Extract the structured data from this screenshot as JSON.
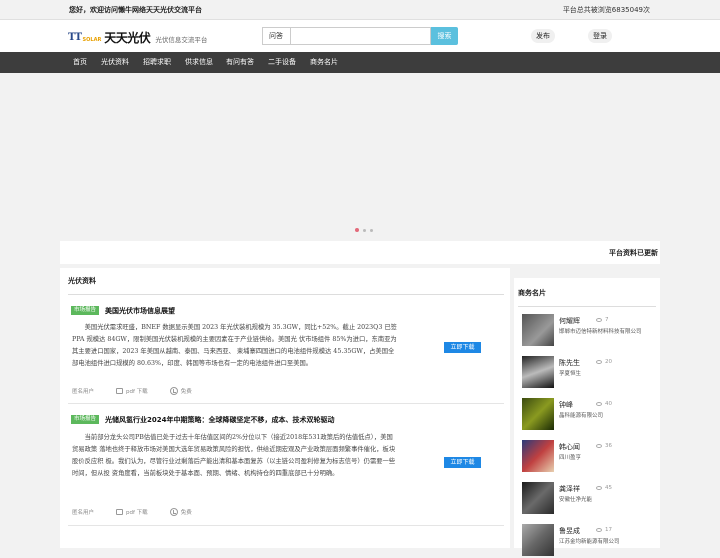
{
  "topbar": {
    "welcome": "您好，欢迎访问懒牛网络天天光伏交流平台",
    "views": "平台总共被浏览6835049次"
  },
  "header": {
    "logo_tt": "TT",
    "logo_solar": "SOLAR",
    "logo_cn": "天天光伏",
    "slogan": "光伏信息交流平台",
    "search_type": "问答",
    "search_value": "",
    "search_button": "搜索",
    "publish": "发布",
    "login": "登录"
  },
  "nav": [
    "首页",
    "光伏资料",
    "招聘求职",
    "供求信息",
    "有问有答",
    "二手设备",
    "商务名片"
  ],
  "notice": {
    "title": "平台资料已更新"
  },
  "main": {
    "section_title": "光伏资料",
    "articles": [
      {
        "tag": "市场报告",
        "title": "美国光伏市场信息展望",
        "body": "美国光伏需求旺盛，BNEF 数据显示美国 2023 年光伏装机规模为 35.3GW，同比+52%。截止 2023Q3 已签 PPA 规模达 84GW，限制美国光伏装机规模的主要因素在于产业链供给。美国光 伏市场组件 85%为进口，东南亚为其主要进口国家，2023 年美国从越南、泰国、马来西亚、 柬埔寨四国进口的电池组件规模达 45.35GW，占美国全部电池组件进口规模的 80.63%，印度、韩国等市场也有一定的电池组件进口至美国。",
        "download": "立即下载",
        "author": "匿名用户",
        "file": "pdf 下载",
        "price": "免费"
      },
      {
        "tag": "市场报告",
        "title": "光储风氢行业2024年中期策略：全球降碳坚定不移，成本、技术双轮驱动",
        "body": "当前部分龙头公司PB估值已处于过去十年估值区间的2%分位以下（接近2018年531政策后的估值低点），美国贸易政策 落地也终于释放市场对美国大选年贸易政策风险的担忧，供给近期宏观及产业政策层面频繁事件催化，板块股价反应积 极。我们认为，尽管行业过剩落后产能出清和基本面复苏（以主链公司盈利修复为标志信号）仍需要一些时间，但从投 资角度看，当前板块处于基本面、预期、情绪、机构持仓的四重底部已十分明确。",
        "download": "立即下载",
        "author": "匿名用户",
        "file": "pdf 下载",
        "price": "免费"
      }
    ]
  },
  "side": {
    "title": "商务名片",
    "cards": [
      {
        "name": "何耀辉",
        "num": "7",
        "org": "邯郸市迈信特新材料科技有限公司"
      },
      {
        "name": "陈先生",
        "num": "20",
        "org": "孚夏恒生"
      },
      {
        "name": "钟峰",
        "num": "40",
        "org": "晶科能源有限公司"
      },
      {
        "name": "韩心闻",
        "num": "36",
        "org": "四川盈亨"
      },
      {
        "name": "龚泽祥",
        "num": "45",
        "org": "安徽仕净光能"
      },
      {
        "name": "鲁昱成",
        "num": "17",
        "org": "江苏金均新能源有限公司"
      }
    ]
  },
  "colors": {
    "nav_bg": "#3d3d3d",
    "tag_green": "#5cb85c",
    "download_blue": "#1e88e5",
    "search_btn": "#5bc0de"
  }
}
